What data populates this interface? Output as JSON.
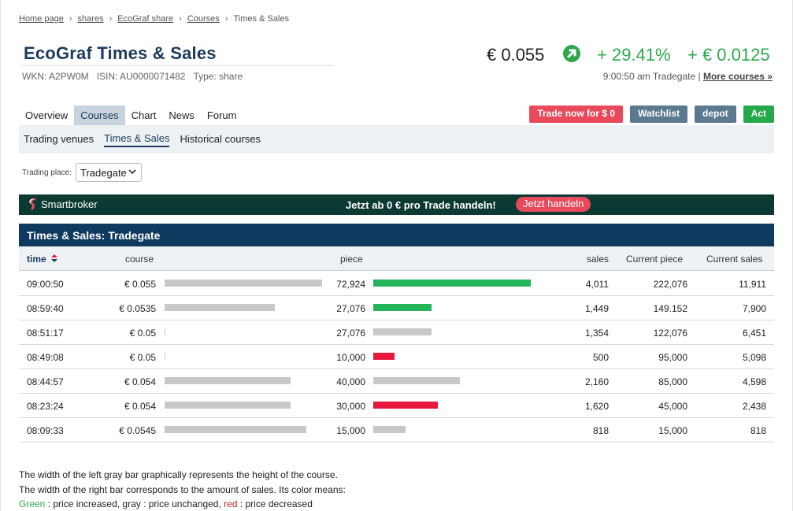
{
  "breadcrumb": {
    "items": [
      "Home page",
      "shares",
      "EcoGraf share",
      "Courses"
    ],
    "current": "Times & Sales",
    "sep": "›"
  },
  "header": {
    "title": "EcoGraf Times & Sales",
    "wkn": "WKN: A2PW0M",
    "isin": "ISIN: AU0000071482",
    "type": "Type: share",
    "price": "€ 0.055",
    "change_pct": "+ 29.41%",
    "change_abs": "+ € 0.0125",
    "time_place": "9:00:50 am Tradegate |",
    "more_courses": "More courses »",
    "trend_icon": "arrow-up-right-icon"
  },
  "tabs": [
    "Overview",
    "Courses",
    "Chart",
    "News",
    "Forum"
  ],
  "active_tab": "Courses",
  "subtabs": [
    "Trading venues",
    "Times & Sales",
    "Historical courses"
  ],
  "active_subtab": "Times & Sales",
  "buttons": {
    "trade": "Trade now for $ 0",
    "watchlist": "Watchlist",
    "depot": "depot",
    "act": "Act"
  },
  "trading_place": {
    "label": "Trading place:",
    "value": "Tradegate"
  },
  "banner": {
    "brand": "Smartbroker",
    "promo": "Jetzt ab 0 € pro Trade handeln!",
    "cta": "Jetzt handeln"
  },
  "table": {
    "title": "Times & Sales: Tradegate",
    "columns": {
      "time": "time",
      "course": "course",
      "piece": "piece",
      "sales": "sales",
      "current_piece": "Current piece",
      "current_sales": "Current sales"
    },
    "sort_icon": "sort-icon",
    "colors": {
      "up": "#24b45a",
      "same": "#c8c8c8",
      "down": "#e8173c"
    },
    "rows": [
      {
        "time": "09:00:50",
        "course": "€ 0.055",
        "course_num": 0.055,
        "piece": "72,924",
        "piece_num": 72924,
        "trend": "up",
        "sales": "4,011",
        "current_piece": "222,076",
        "current_sales": "11,911"
      },
      {
        "time": "08:59:40",
        "course": "€ 0.0535",
        "course_num": 0.0535,
        "piece": "27,076",
        "piece_num": 27076,
        "trend": "up",
        "sales": "1,449",
        "current_piece": "149.152",
        "current_sales": "7,900"
      },
      {
        "time": "08:51:17",
        "course": "€ 0.05",
        "course_num": 0.05,
        "piece": "27,076",
        "piece_num": 27076,
        "trend": "same",
        "sales": "1,354",
        "current_piece": "122,076",
        "current_sales": "6,451"
      },
      {
        "time": "08:49:08",
        "course": "€ 0.05",
        "course_num": 0.05,
        "piece": "10,000",
        "piece_num": 10000,
        "trend": "down",
        "sales": "500",
        "current_piece": "95,000",
        "current_sales": "5,098"
      },
      {
        "time": "08:44:57",
        "course": "€ 0.054",
        "course_num": 0.054,
        "piece": "40,000",
        "piece_num": 40000,
        "trend": "same",
        "sales": "2,160",
        "current_piece": "85,000",
        "current_sales": "4,598"
      },
      {
        "time": "08:23:24",
        "course": "€ 0.054",
        "course_num": 0.054,
        "piece": "30,000",
        "piece_num": 30000,
        "trend": "down",
        "sales": "1,620",
        "current_piece": "45,000",
        "current_sales": "2,438"
      },
      {
        "time": "08:09:33",
        "course": "€ 0.0545",
        "course_num": 0.0545,
        "piece": "15,000",
        "piece_num": 15000,
        "trend": "same",
        "sales": "818",
        "current_piece": "15,000",
        "current_sales": "818"
      }
    ]
  },
  "notes": {
    "line1": "The width of the left gray bar graphically represents the height of the course.",
    "line2": "The width of the right bar corresponds to the amount of sales. Its color means:",
    "green": "Green",
    "green_text": " : price increased, gray : price unchanged, ",
    "red": "red",
    "red_text": " : price decreased"
  }
}
